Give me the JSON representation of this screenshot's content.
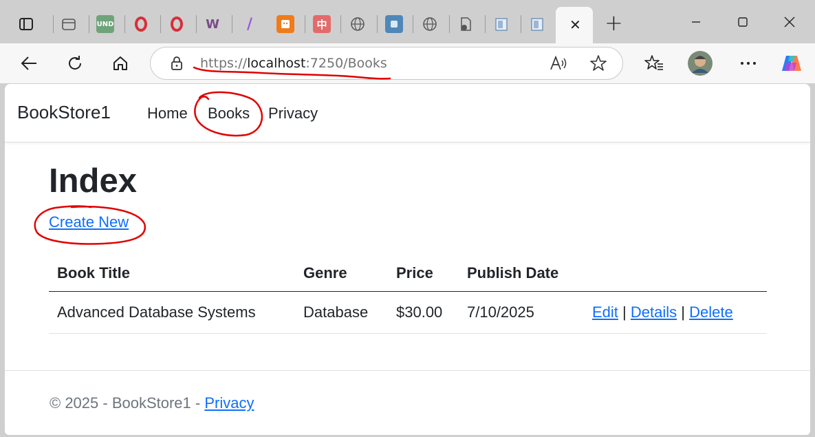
{
  "browser": {
    "active_tab_close": "✕",
    "new_tab": "+",
    "url_scheme": "https://",
    "url_host": "localhost",
    "url_path": ":7250/Books"
  },
  "page": {
    "brand": "BookStore1",
    "nav": {
      "home": "Home",
      "books": "Books",
      "privacy": "Privacy"
    },
    "heading": "Index",
    "create_link": "Create New",
    "table": {
      "headers": [
        "Book Title",
        "Genre",
        "Price",
        "Publish Date"
      ],
      "rows": [
        {
          "title": "Advanced Database Systems",
          "genre": "Database",
          "price": "$30.00",
          "date": "7/10/2025",
          "edit": "Edit",
          "sep1": "|",
          "details": "Details",
          "sep2": "|",
          "delete": "Delete"
        }
      ]
    },
    "footer": {
      "text": "© 2025 - BookStore1 - ",
      "privacy": "Privacy"
    }
  },
  "colors": {
    "link": "#0d6efd",
    "annotation": "#e00000",
    "tab_strip": "#cfcfcf"
  },
  "icons": [
    "tab-actions-icon",
    "refresh-icon",
    "home-icon",
    "lock-icon",
    "read-aloud-icon",
    "favorite-star-icon",
    "favorites-icon",
    "profile-avatar",
    "more-icon",
    "copilot-icon"
  ]
}
